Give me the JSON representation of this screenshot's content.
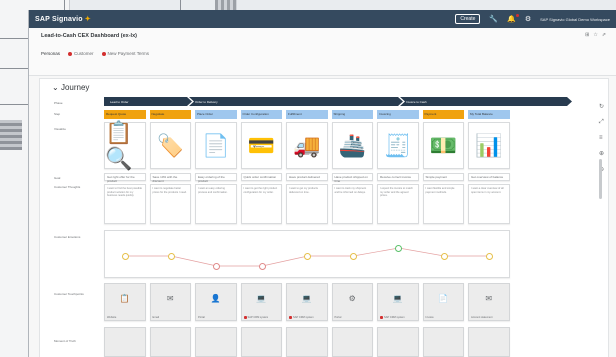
{
  "shell": {
    "logo": "SAP Signavio",
    "create_label": "Create",
    "user_label": "SAP Signavio Global Demo Workspace"
  },
  "page": {
    "title": "Lead-to-Cash CEX Dashboard (ex-lx)",
    "persona_label": "Personas",
    "personas": [
      "Customer",
      "New Payment Terms"
    ]
  },
  "journey": {
    "title": "Journey",
    "row_labels": [
      "Phase",
      "Step",
      "Visualize",
      "Goal",
      "Customer Thoughts",
      "Customer Emotions",
      "Customer Touchpoints",
      "Moment of Truth"
    ],
    "phases": [
      "Lead to Order",
      "Order to Delivery",
      "Invoice to Cash"
    ],
    "steps": [
      {
        "label": "Request Quote",
        "style": "o"
      },
      {
        "label": "Negotiate",
        "style": "o"
      },
      {
        "label": "Place Order",
        "style": "b"
      },
      {
        "label": "Order Configuration",
        "style": "b"
      },
      {
        "label": "Fulfillment",
        "style": "b"
      },
      {
        "label": "Shipping",
        "style": "b"
      },
      {
        "label": "Invoicing",
        "style": "b"
      },
      {
        "label": "Payment",
        "style": "o"
      },
      {
        "label": "My Total Balance",
        "style": "b"
      }
    ],
    "visuals": [
      "📋🔍",
      "🏷️",
      "📄",
      "💳",
      "🚚",
      "🚢",
      "🧾",
      "💵",
      "📊"
    ],
    "goals": [
      "Get right offer for the product",
      "Save 10% with the discount",
      "Easy ordering of the product",
      "Quick order confirmation",
      "Have product delivered",
      "Have product shipped on time",
      "Receive correct invoice",
      "Simple payment",
      "Get overview of balance"
    ],
    "thoughts": [
      "I want to find the best possible product solution for my business needs quickly.",
      "I want to negotiate better prices for the products I need.",
      "I want an easy ordering process and confirmation.",
      "I want to get the right product configuration for my order.",
      "I want to get my products delivered on time.",
      "I want to track my shipment and be informed on delays.",
      "I expect the invoice to match my order and the agreed prices.",
      "I want flexible and simple payment methods.",
      "I want a clear overview of all open items in my account."
    ],
    "touchpoints": [
      {
        "icon": "📋",
        "cap": "Website",
        "red": false
      },
      {
        "icon": "✉",
        "cap": "Email",
        "red": false
      },
      {
        "icon": "👤",
        "cap": "Portal",
        "red": false
      },
      {
        "icon": "💻",
        "cap": "SAP CRM system",
        "red": true
      },
      {
        "icon": "💻",
        "cap": "SAP CRM system",
        "red": true
      },
      {
        "icon": "⚙",
        "cap": "Portal",
        "red": false
      },
      {
        "icon": "💻",
        "cap": "SAP CRM system",
        "red": true
      },
      {
        "icon": "📄",
        "cap": "Invoice",
        "red": false
      },
      {
        "icon": "✉",
        "cap": "Account statement",
        "red": false
      }
    ],
    "emotions": [
      "neutral",
      "neutral",
      "bad",
      "bad",
      "neutral",
      "neutral",
      "good",
      "neutral",
      "neutral"
    ]
  }
}
